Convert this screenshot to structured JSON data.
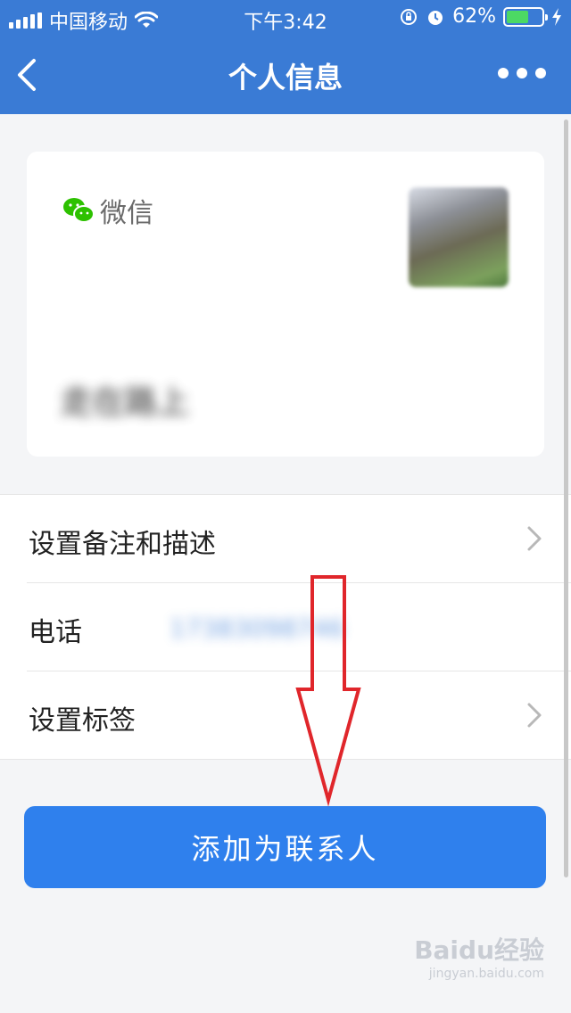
{
  "status_bar": {
    "carrier": "中国移动",
    "time": "下午3:42",
    "battery_percent": "62%",
    "battery_level": 0.62
  },
  "navbar": {
    "title": "个人信息"
  },
  "profile": {
    "brand_label": "微信",
    "nickname": "走在路上"
  },
  "list": {
    "remark_label": "设置备注和描述",
    "phone_label": "电话",
    "phone_value": "17383098746",
    "tags_label": "设置标签"
  },
  "actions": {
    "add_contact_label": "添加为联系人"
  },
  "watermark": {
    "text": "Baidu经验",
    "subtext": "jingyan.baidu.com"
  },
  "colors": {
    "accent": "#3a7bd5",
    "button": "#2f80ed",
    "annotation_arrow": "#e0262b",
    "wechat_green": "#2dc100"
  },
  "icons": [
    "back-chevron-icon",
    "more-dots-icon",
    "wechat-icon",
    "chevron-right-icon",
    "wifi-icon",
    "alarm-icon",
    "rotation-lock-icon",
    "charging-icon"
  ]
}
